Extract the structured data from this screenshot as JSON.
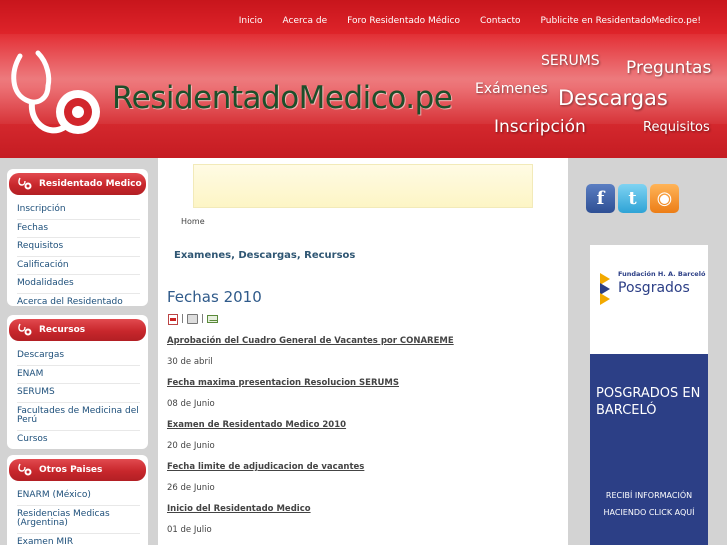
{
  "topnav": {
    "items": [
      "Inicio",
      "Acerca de",
      "Foro Residentado Médico",
      "Contacto",
      "Publicite en ResidentadoMedico.pe!"
    ]
  },
  "header": {
    "site_title": "ResidentadoMedico.pe",
    "words": {
      "serums": "SERUMS",
      "preguntas": "Preguntas",
      "examenes": "Exámenes",
      "descargas": "Descargas",
      "inscripcion": "Inscripción",
      "requisitos": "Requisitos"
    }
  },
  "sidebar": {
    "boxes": [
      {
        "title": "Residentado Medico",
        "items": [
          "Inscripción",
          "Fechas",
          "Requisitos",
          "Calificación",
          "Modalidades",
          "Acerca del Residentado"
        ]
      },
      {
        "title": "Recursos",
        "items": [
          "Descargas",
          "ENAM",
          "SERUMS",
          "Facultades de Medicina del Perú",
          "Cursos"
        ]
      },
      {
        "title": "Otros Paises",
        "items": [
          "ENARM (México)",
          "Residencias Medicas (Argentina)",
          "Examen MIR"
        ]
      }
    ]
  },
  "main": {
    "breadcrumb": "Home",
    "section_title": "Examenes, Descargas, Recursos",
    "page_title": "Fechas 2010",
    "icon_separator": "|",
    "events": [
      {
        "title": "Aprobación del Cuadro General de Vacantes por CONAREME",
        "date": "30 de abril"
      },
      {
        "title": "Fecha maxima presentacion Resolucion SERUMS",
        "date": "08 de Junio"
      },
      {
        "title": "Examen de Residentado Medico 2010",
        "date": "20 de Junio"
      },
      {
        "title": "Fecha limite de adjudicacion de vacantes",
        "date": "26 de Junio"
      },
      {
        "title": "Inicio del Residentado Medico",
        "date": "01 de Julio"
      }
    ]
  },
  "right": {
    "social": [
      {
        "name": "facebook-icon",
        "glyph": "f"
      },
      {
        "name": "twitter-icon",
        "glyph": "t"
      },
      {
        "name": "rss-icon",
        "glyph": "◉"
      }
    ],
    "banner": {
      "org": "Fundación H. A. Barceló",
      "brand": "Posgrados",
      "headline": "POSGRADOS EN BARCELÓ",
      "cta": "RECIBÍ INFORMACIÓN HACIENDO CLICK AQUÍ"
    }
  },
  "colors": {
    "header_red": "#d42329",
    "title_green": "#1d4f2a",
    "link_blue": "#1d4f7a",
    "banner_blue": "#2c3f86"
  }
}
